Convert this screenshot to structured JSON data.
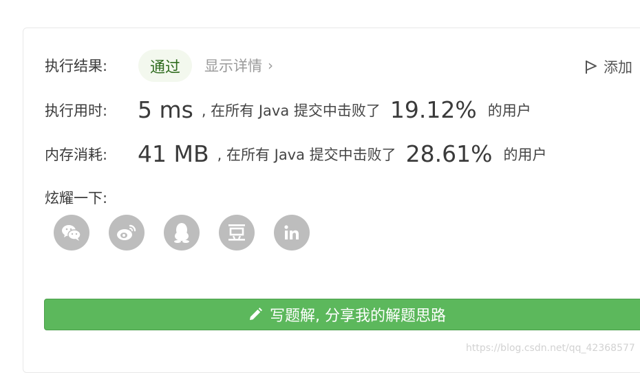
{
  "result": {
    "label": "执行结果:",
    "status": "通过",
    "details_link": "显示详情",
    "add_note": "添加"
  },
  "runtime": {
    "label": "执行用时:",
    "value": "5 ms",
    "prefix": ", 在所有 Java 提交中击败了",
    "percent": "19.12%",
    "suffix": "的用户"
  },
  "memory": {
    "label": "内存消耗:",
    "value": "41 MB",
    "prefix": ", 在所有 Java 提交中击败了",
    "percent": "28.61%",
    "suffix": "的用户"
  },
  "share": {
    "label": "炫耀一下:",
    "icons": [
      "wechat-icon",
      "weibo-icon",
      "qq-icon",
      "douban-icon",
      "linkedin-icon"
    ]
  },
  "write_solution": {
    "label": "写题解, 分享我的解题思路"
  },
  "watermark": "https://blog.csdn.net/qq_42368577",
  "colors": {
    "accent_green": "#5cb85c",
    "pass_bg": "#f3f8ee",
    "pass_text": "#2f6b1e",
    "icon_gray": "#bdbdbd"
  }
}
